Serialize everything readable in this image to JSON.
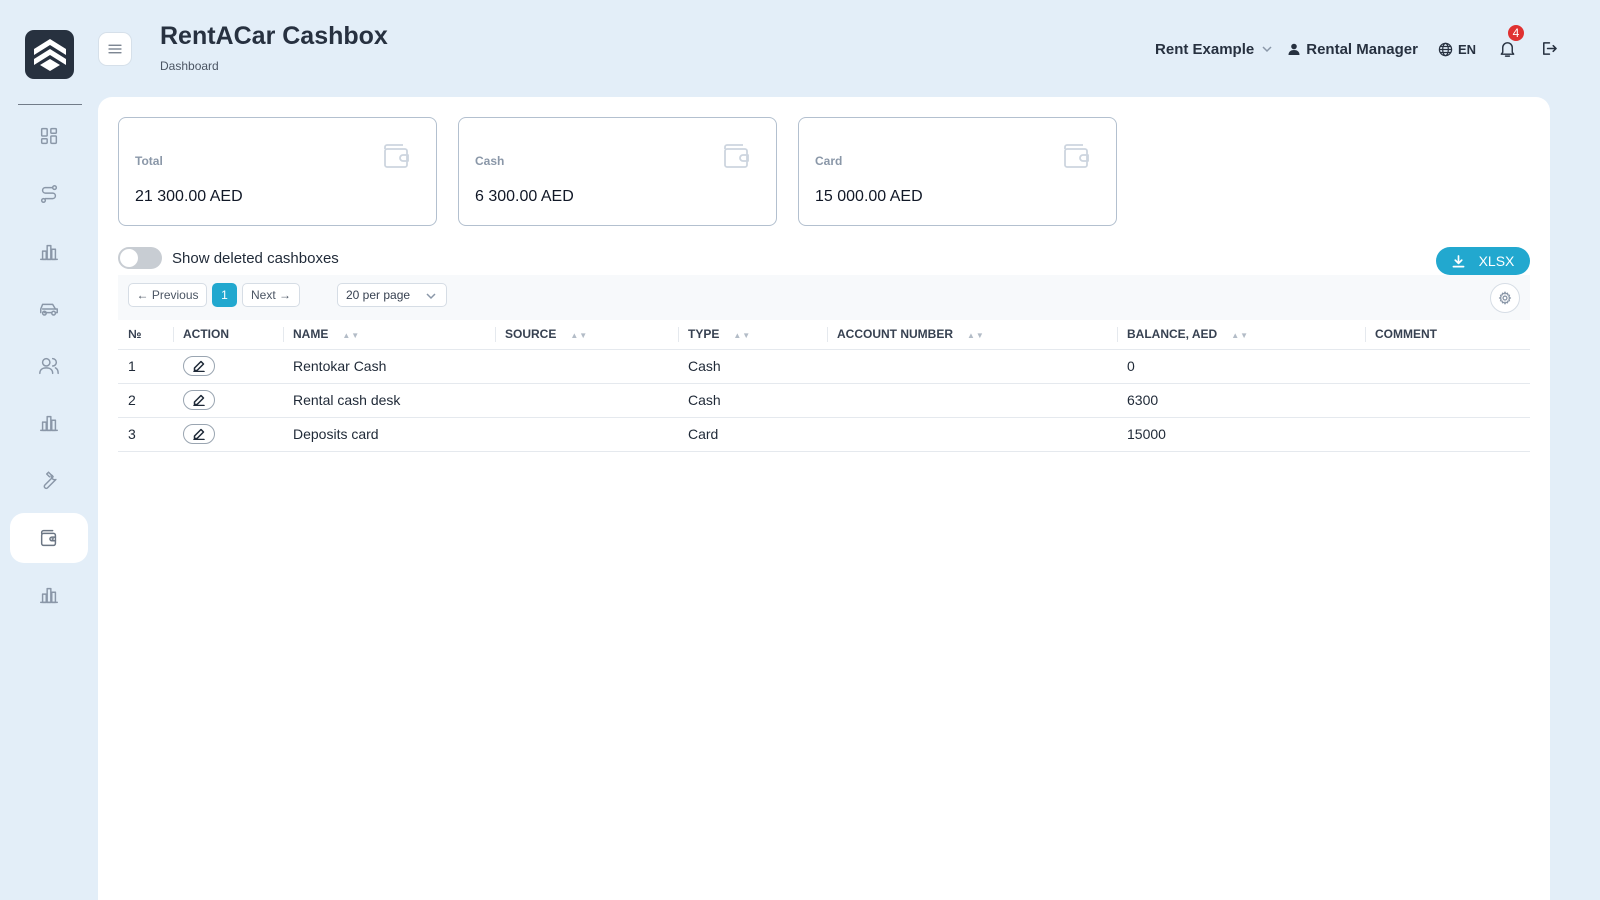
{
  "header": {
    "title": "RentACar Cashbox",
    "breadcrumb": "Dashboard",
    "company": "Rent Example",
    "user": "Rental Manager",
    "language": "EN",
    "notifications_count": "4"
  },
  "sidebar": {
    "items": [
      {
        "name": "dashboard",
        "icon": "grid-icon"
      },
      {
        "name": "routes",
        "icon": "route-icon"
      },
      {
        "name": "reports",
        "icon": "bar-chart-icon"
      },
      {
        "name": "cars",
        "icon": "car-icon"
      },
      {
        "name": "users",
        "icon": "users-icon"
      },
      {
        "name": "stats",
        "icon": "bar-chart-icon"
      },
      {
        "name": "service",
        "icon": "wrench-icon"
      },
      {
        "name": "cashbox",
        "icon": "wallet-icon",
        "active": true
      },
      {
        "name": "analytics",
        "icon": "bar-chart-icon"
      }
    ]
  },
  "summary_cards": [
    {
      "label": "Total",
      "value": "21 300.00 AED"
    },
    {
      "label": "Cash",
      "value": "6 300.00 AED"
    },
    {
      "label": "Card",
      "value": "15 000.00 AED"
    }
  ],
  "filters": {
    "show_deleted_label": "Show deleted cashboxes",
    "show_deleted": false,
    "export_label": "XLSX"
  },
  "pagination": {
    "previous_label": "← Previous",
    "current_page": "1",
    "next_label": "Next →",
    "per_page": "20 per page"
  },
  "table": {
    "columns": [
      "№",
      "ACTION",
      "NAME",
      "SOURCE",
      "TYPE",
      "ACCOUNT NUMBER",
      "BALANCE, AED",
      "COMMENT"
    ],
    "rows": [
      {
        "no": "1",
        "name": "Rentokar Cash",
        "source": "",
        "type": "Cash",
        "account": "",
        "balance": "0",
        "comment": ""
      },
      {
        "no": "2",
        "name": "Rental cash desk",
        "source": "",
        "type": "Cash",
        "account": "",
        "balance": "6300",
        "comment": ""
      },
      {
        "no": "3",
        "name": "Deposits card",
        "source": "",
        "type": "Card",
        "account": "",
        "balance": "15000",
        "comment": ""
      }
    ]
  },
  "colors": {
    "accent": "#22a8cf",
    "background": "#e3eef8",
    "badge": "#e03131"
  }
}
